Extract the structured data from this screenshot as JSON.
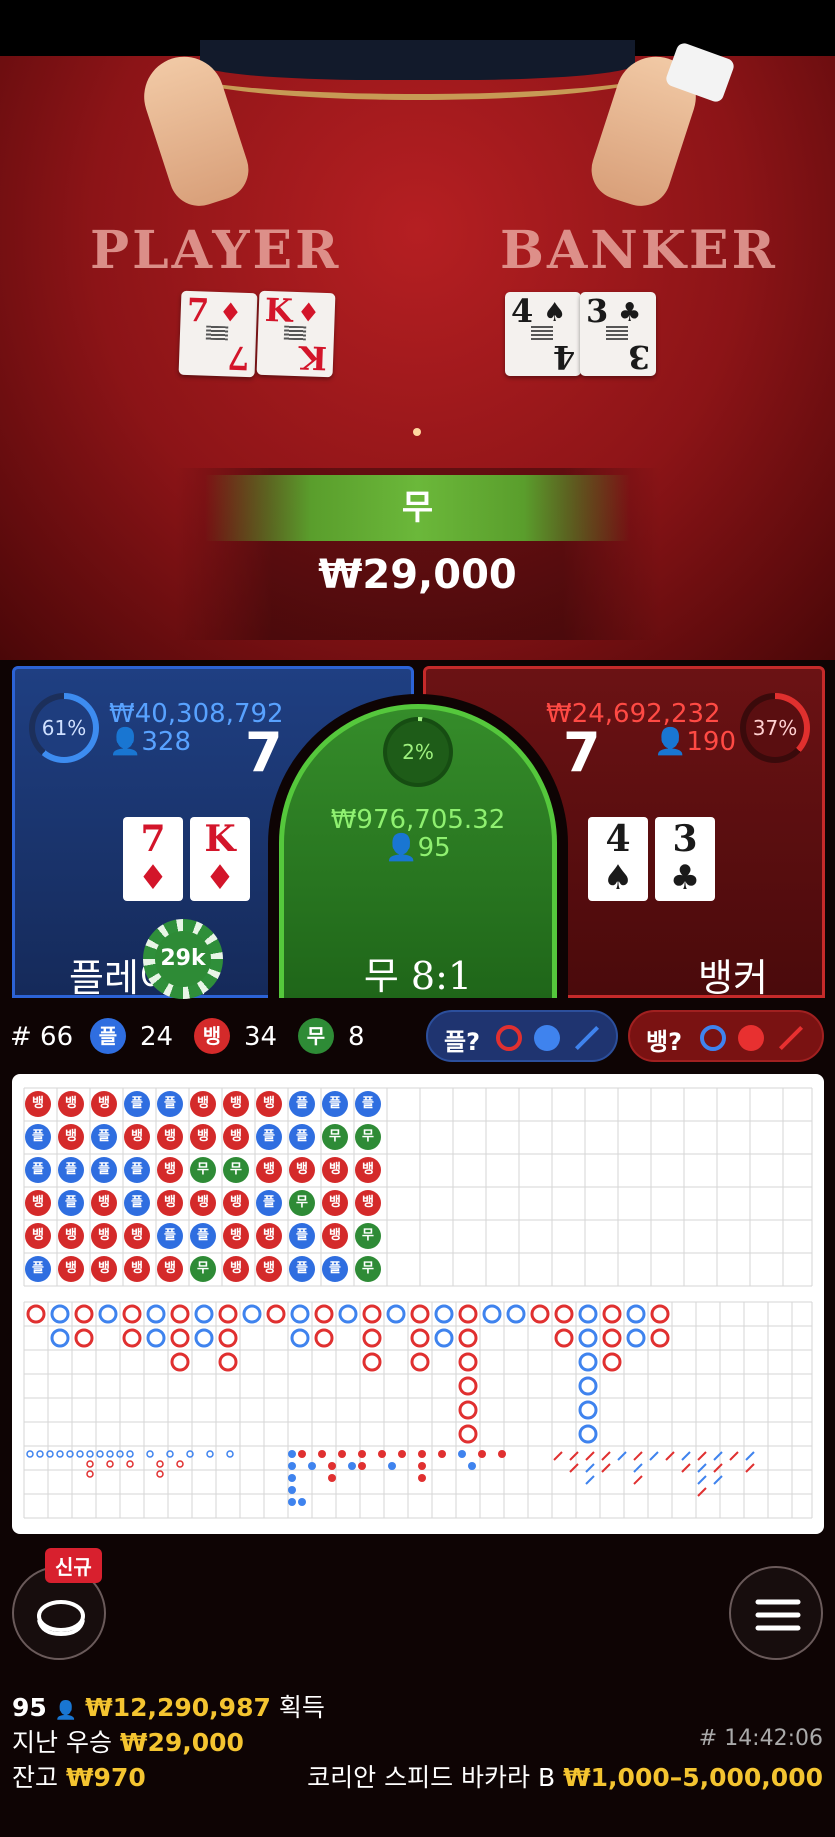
{
  "table": {
    "player_label": "PLAYER",
    "banker_label": "BANKER"
  },
  "result": {
    "label": "무",
    "amount": "₩29,000"
  },
  "player": {
    "percent": "61%",
    "total": "₩40,308,792",
    "bettors": "328",
    "score": "7",
    "label": "플레이어",
    "cards": [
      {
        "rank": "7",
        "suit": "♦"
      },
      {
        "rank": "K",
        "suit": "♦"
      }
    ],
    "chip": "29k"
  },
  "tie": {
    "percent": "2%",
    "total": "₩976,705.32",
    "bettors": "95",
    "label": "무 8:1"
  },
  "banker": {
    "percent": "37%",
    "total": "₩24,692,232",
    "bettors": "190",
    "score": "7",
    "label": "뱅커",
    "cards": [
      {
        "rank": "4",
        "suit": "♠"
      },
      {
        "rank": "3",
        "suit": "♣"
      }
    ]
  },
  "stats": {
    "round": "# 66",
    "player_badge": "플",
    "player_count": "24",
    "banker_badge": "뱅",
    "banker_count": "34",
    "tie_badge": "무",
    "tie_count": "8",
    "player_predict": "플?",
    "banker_predict": "뱅?"
  },
  "bead_road": [
    [
      "뱅",
      "플",
      "플",
      "뱅",
      "뱅",
      "플"
    ],
    [
      "뱅",
      "뱅",
      "플",
      "플",
      "뱅",
      "뱅"
    ],
    [
      "뱅",
      "플",
      "플",
      "뱅",
      "뱅",
      "뱅"
    ],
    [
      "플",
      "뱅",
      "플",
      "플",
      "뱅",
      "뱅"
    ],
    [
      "플",
      "뱅",
      "뱅",
      "뱅",
      "플",
      "뱅"
    ],
    [
      "뱅",
      "뱅",
      "무",
      "뱅",
      "플",
      "무"
    ],
    [
      "뱅",
      "뱅",
      "무",
      "뱅",
      "뱅",
      "뱅"
    ],
    [
      "뱅",
      "플",
      "뱅",
      "플",
      "뱅",
      "뱅"
    ],
    [
      "플",
      "플",
      "뱅",
      "무",
      "플",
      "플"
    ],
    [
      "플",
      "무",
      "뱅",
      "뱅",
      "뱅",
      "플"
    ],
    [
      "플",
      "무",
      "뱅",
      "뱅",
      "무",
      "무"
    ]
  ],
  "footer": {
    "winners_count": "95",
    "winners_amount": "₩12,290,987",
    "winners_suffix": "획득",
    "last_win_label": "지난 우승",
    "last_win_amount": "₩29,000",
    "balance_label": "잔고",
    "balance_amount": "₩970",
    "time": "# 14:42:06",
    "game_name": "코리안 스피드 바카라 B",
    "limits": "₩1,000–5,000,000",
    "new_badge": "신규"
  },
  "colors": {
    "player": "#2f6ee0",
    "banker": "#d42a2a",
    "tie": "#2e8b36",
    "gold": "#f4c430"
  },
  "icons": {
    "chat": "chat-icon",
    "menu": "hamburger-menu-icon",
    "person": "person-icon"
  }
}
